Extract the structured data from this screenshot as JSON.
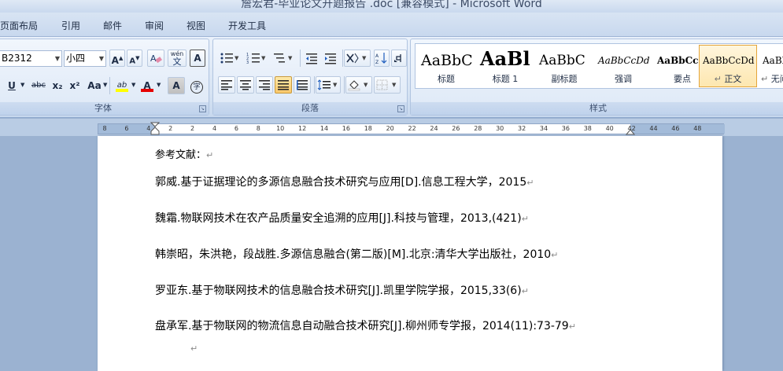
{
  "window": {
    "title": "詹宏君-毕业论文开题报告 .doc [兼容模式] - Microsoft Word"
  },
  "menu": {
    "tabs": [
      "页面布局",
      "引用",
      "邮件",
      "审阅",
      "视图",
      "开发工具"
    ]
  },
  "ribbon": {
    "font": {
      "font_name": "B2312",
      "font_size": "小四",
      "grow_label": "A",
      "shrink_label": "A",
      "wen_label": "wén",
      "underline_label": "U",
      "strike_label": "abc",
      "subscript_label": "x₂",
      "superscript_label": "x²",
      "case_label": "Aa",
      "highlight_label": "ab",
      "color_label": "A",
      "char_shading_label": "A",
      "enclose_label": "字",
      "group_label": "字体"
    },
    "paragraph": {
      "group_label": "段落"
    },
    "styles": {
      "group_label": "样式",
      "items": [
        {
          "sample": "AaBbC",
          "name": "标题"
        },
        {
          "sample": "AaBl",
          "name": "标题 1"
        },
        {
          "sample": "AaBbC",
          "name": "副标题"
        },
        {
          "sample": "AaBbCcDd",
          "name": "强调"
        },
        {
          "sample": "AaBbCcD",
          "name": "要点"
        },
        {
          "sample": "AaBbCcDd",
          "name": "正文",
          "selected": true
        },
        {
          "sample": "AaBb",
          "name": "无间"
        }
      ]
    }
  },
  "ruler": {
    "ticks": [
      "8",
      "6",
      "4",
      "2",
      "2",
      "4",
      "6",
      "8",
      "10",
      "12",
      "14",
      "16",
      "18",
      "20",
      "22",
      "24",
      "26",
      "28",
      "30",
      "32",
      "34",
      "36",
      "38",
      "40",
      "42",
      "44",
      "46",
      "48"
    ]
  },
  "document": {
    "heading": "参考文献：",
    "references": [
      "郭威.基于证据理论的多源信息融合技术研究与应用[D].信息工程大学，2015",
      "魏霜.物联网技术在农产品质量安全追溯的应用[J].科技与管理，2013,(421)",
      "韩崇昭，朱洪艳，段战胜.多源信息融合(第二版)[M].北京:清华大学出版社，2010",
      "罗亚东.基于物联网技术的信息融合技术研究[J].凯里学院学报，2015,33(6)",
      "盘承军.基于物联网的物流信息自动融合技术研究[J].柳州师专学报，2014(11):73-79"
    ],
    "pilcrow": "↵"
  }
}
